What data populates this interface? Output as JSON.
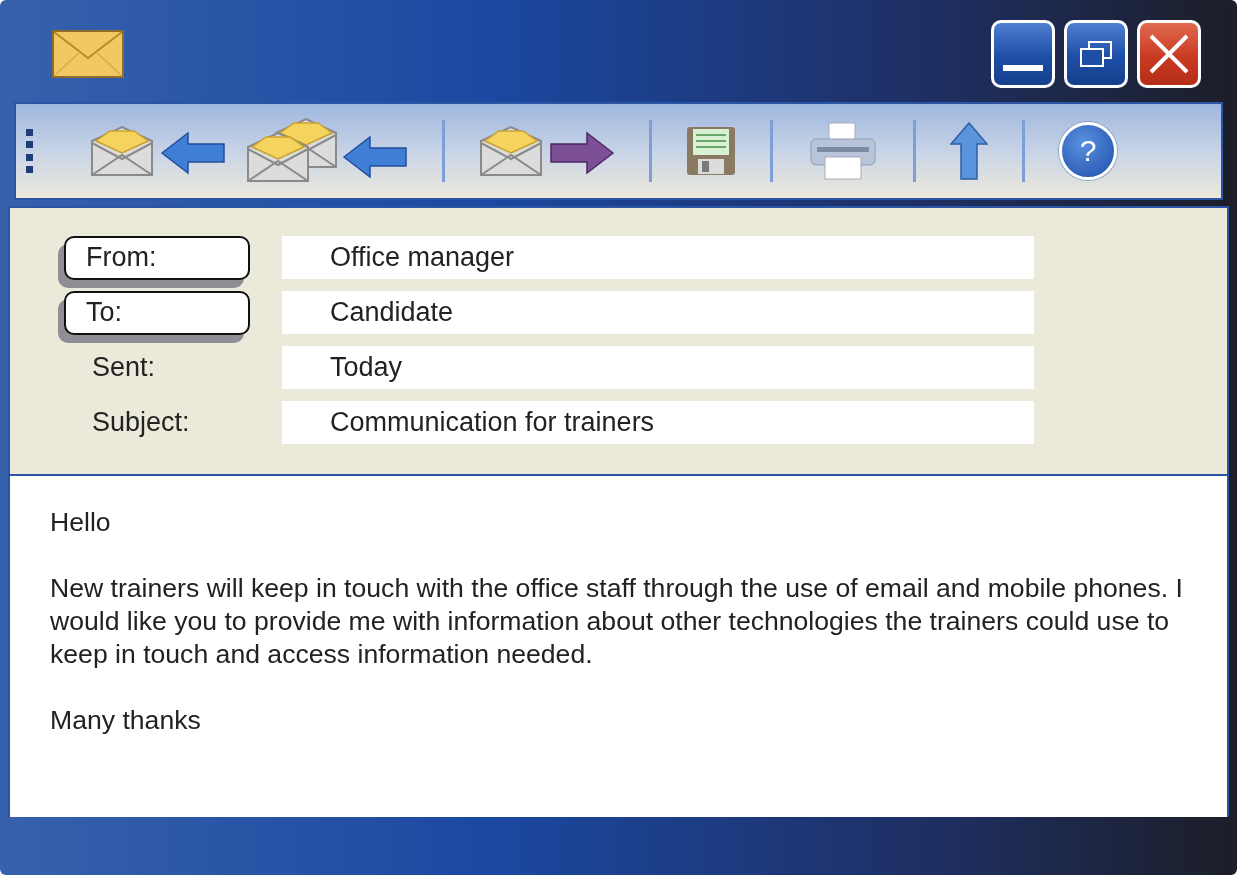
{
  "toolbar": {
    "groups": [
      [
        {
          "kind": "reply"
        },
        {
          "kind": "reply_all"
        }
      ],
      [
        {
          "kind": "forward"
        }
      ],
      [
        {
          "kind": "save"
        }
      ],
      [
        {
          "kind": "print"
        }
      ],
      [
        {
          "kind": "up"
        }
      ],
      [
        {
          "kind": "help",
          "label": "?"
        }
      ]
    ]
  },
  "header_fields": [
    {
      "kind": "button",
      "label": "From:",
      "value": "Office manager"
    },
    {
      "kind": "button",
      "label": "To:",
      "value": "Candidate"
    },
    {
      "kind": "plain",
      "label": "Sent:",
      "value": "Today"
    },
    {
      "kind": "plain",
      "label": "Subject:",
      "value": "Communication for trainers"
    }
  ],
  "body": [
    "Hello",
    "New trainers will keep in touch with the office staff through the use of email and mobile phones. I would like you to provide me with information about other technologies the trainers could use to keep in touch and access information needed.",
    "Many thanks"
  ]
}
